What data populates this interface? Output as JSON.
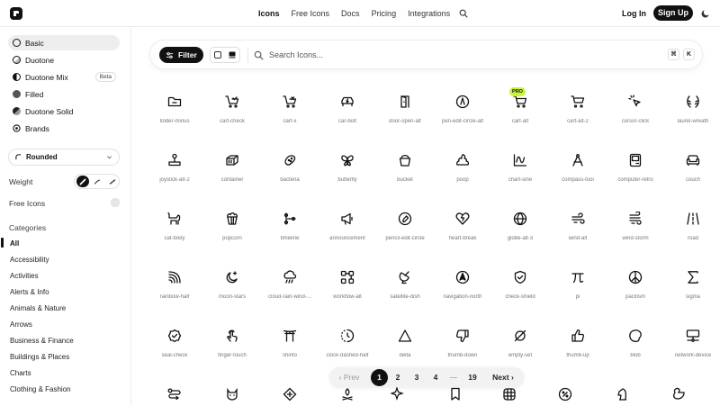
{
  "nav": {
    "links": [
      "Icons",
      "Free Icons",
      "Docs",
      "Pricing",
      "Integrations"
    ],
    "login": "Log In",
    "signup": "Sign Up"
  },
  "sidebar": {
    "styles": [
      {
        "label": "Basic",
        "selected": true
      },
      {
        "label": "Duotone"
      },
      {
        "label": "Duotone Mix",
        "badge": "Beta"
      },
      {
        "label": "Filled"
      },
      {
        "label": "Duotone Solid"
      },
      {
        "label": "Brands"
      }
    ],
    "corner_select": "Rounded",
    "weight_label": "Weight",
    "free_icons_label": "Free Icons",
    "categories_title": "Categories",
    "categories": [
      "All",
      "Accessibility",
      "Activities",
      "Alerts & Info",
      "Animals & Nature",
      "Arrows",
      "Business & Finance",
      "Buildings & Places",
      "Charts",
      "Clothing & Fashion"
    ]
  },
  "toolbar": {
    "filter_label": "Filter",
    "search_placeholder": "Search Icons...",
    "kbd_cmd": "⌘",
    "kbd_k": "K"
  },
  "icons": [
    "folder-minus",
    "cart-check",
    "cart-x",
    "car-bolt",
    "door-open-alt",
    "pen-edit-circle-alt",
    "cart-alt",
    "cart-alt-2",
    "cursor-click",
    "laurel-wreath",
    "joystick-alt-2",
    "container",
    "bacteria",
    "butterfly",
    "bucket",
    "poop",
    "chart-sine",
    "compass-tool",
    "computer-retro",
    "couch",
    "cat-body",
    "popcorn",
    "timeline",
    "announcement",
    "pencil-edit-circle",
    "heart-break",
    "globe-alt-3",
    "wind-alt",
    "wind-storm",
    "road",
    "rainbow-half",
    "moon-stars",
    "cloud-rain-wind-...",
    "workflow-alt",
    "satellite-dish",
    "navigation-north",
    "check-shield",
    "pi",
    "pacifism",
    "sigma",
    "seal-check",
    "finger-touch",
    "shinto",
    "clock-dashed-half",
    "delta",
    "thumb-down",
    "empty-set",
    "thumb-up",
    "blob",
    "network-device"
  ],
  "pro_badge": "PRO",
  "pagination": {
    "prev": "Prev",
    "pages": [
      "1",
      "2",
      "3",
      "4",
      "···",
      "19"
    ],
    "current": "1",
    "next": "Next"
  }
}
